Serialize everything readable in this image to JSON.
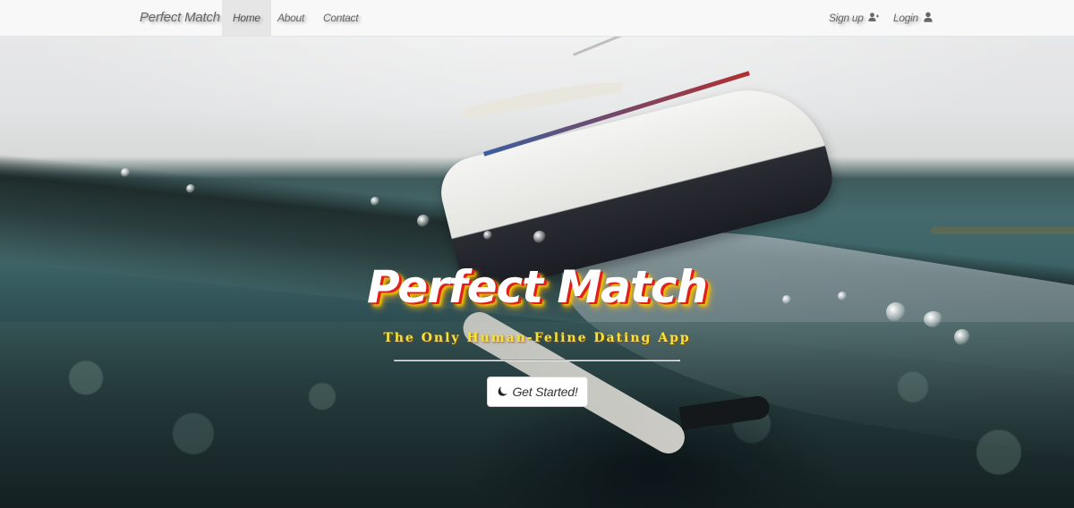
{
  "navbar": {
    "brand": "Perfect Match",
    "links": [
      {
        "label": "Home",
        "active": true
      },
      {
        "label": "About",
        "active": false
      },
      {
        "label": "Contact",
        "active": false
      }
    ],
    "right_links": [
      {
        "label": "Sign up",
        "icon": "user-plus-icon"
      },
      {
        "label": "Login",
        "icon": "user-icon"
      }
    ]
  },
  "hero": {
    "title": "Perfect Match",
    "subtitle": "The Only Human-Feline Dating App",
    "cta": {
      "label": "Get Started!",
      "icon": "moon-icon"
    }
  },
  "colors": {
    "title_text": "#ffffff",
    "title_shadow_red": "#e02020",
    "title_shadow_yellow": "#f6c400",
    "subtitle": "#f3e43a",
    "navbar_bg": "#f8f8f8",
    "nav_active_bg": "#e6e6e6"
  }
}
